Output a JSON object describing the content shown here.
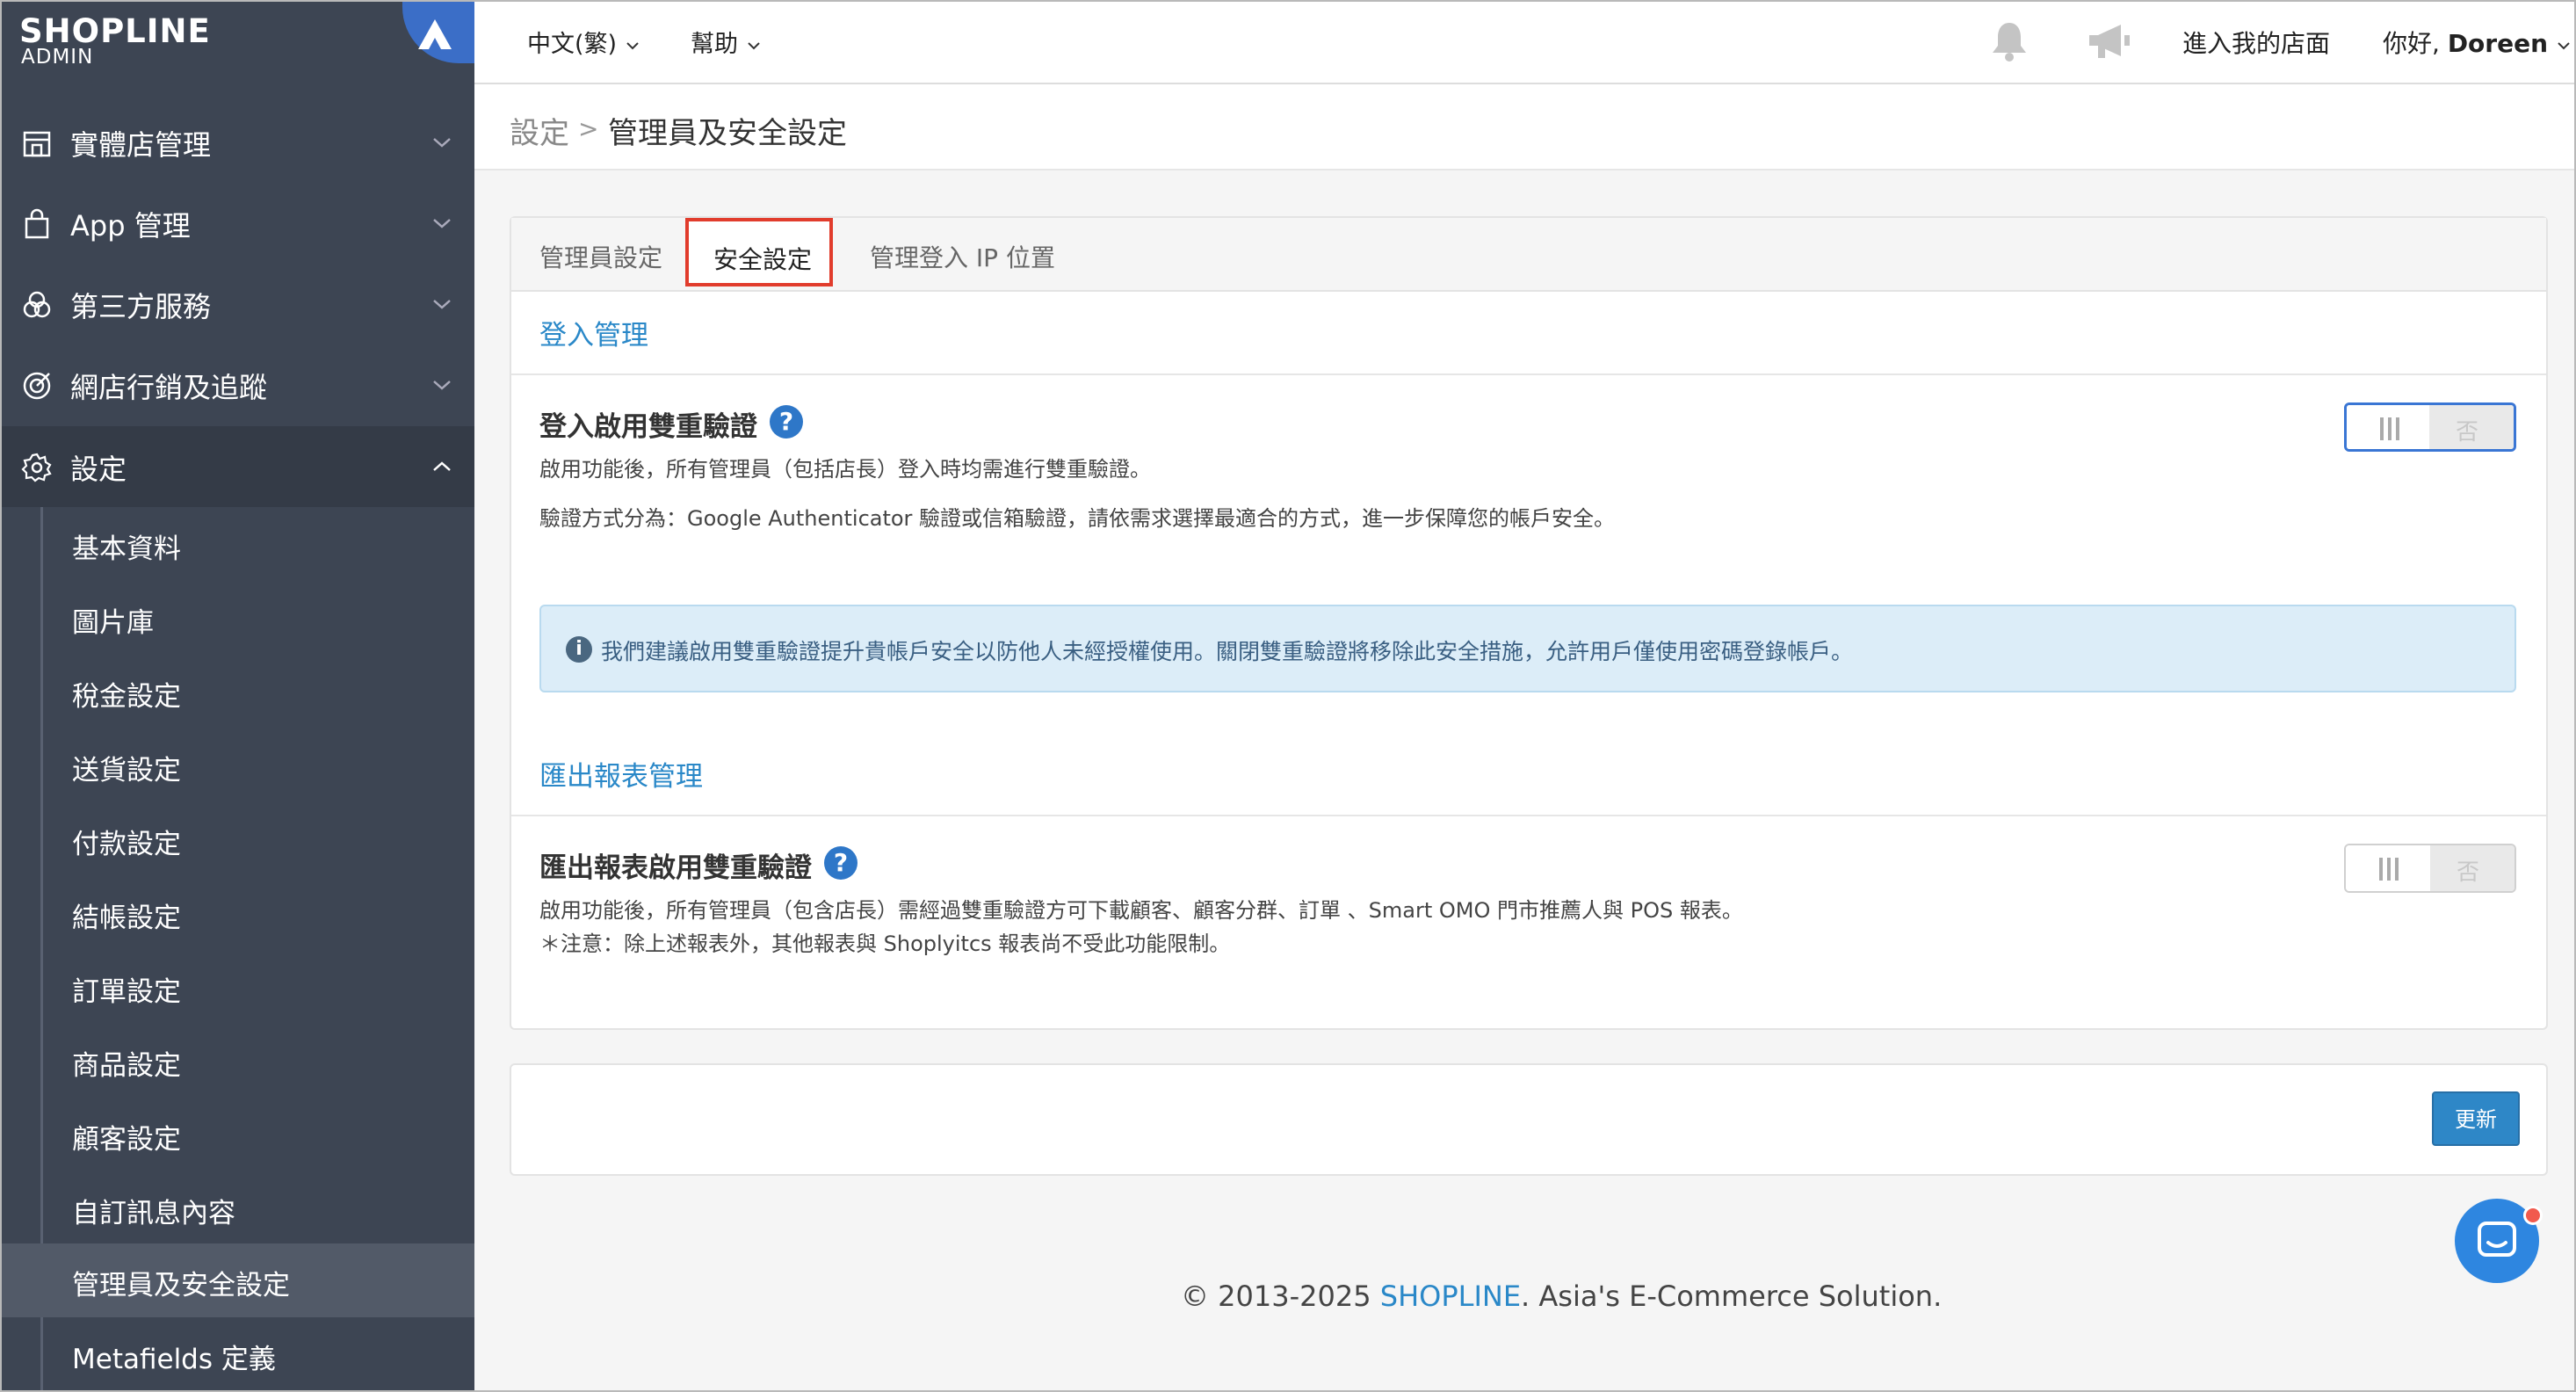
{
  "brand": {
    "name": "SHOPLINE",
    "sub": "ADMIN"
  },
  "sidebar": {
    "items": [
      {
        "label": "實體店管理",
        "icon": "store-icon"
      },
      {
        "label": "App 管理",
        "icon": "shopping-bag-icon"
      },
      {
        "label": "第三方服務",
        "icon": "circles-icon"
      },
      {
        "label": "網店行銷及追蹤",
        "icon": "target-icon"
      },
      {
        "label": "設定",
        "icon": "gear-icon"
      }
    ],
    "sub_items": [
      "基本資料",
      "圖片庫",
      "稅金設定",
      "送貨設定",
      "付款設定",
      "結帳設定",
      "訂單設定",
      "商品設定",
      "顧客設定",
      "自訂訊息內容",
      "管理員及安全設定",
      "Metafields 定義"
    ]
  },
  "topbar": {
    "language": "中文(繁)",
    "help": "幫助",
    "store_link": "進入我的店面",
    "greeting_prefix": "你好, ",
    "user_name": "Doreen"
  },
  "breadcrumb": {
    "parent": "設定",
    "separator": ">",
    "current": "管理員及安全設定"
  },
  "tabs": [
    "管理員設定",
    "安全設定",
    "管理登入 IP 位置"
  ],
  "login_section": {
    "title": "登入管理",
    "setting_title": "登入啟用雙重驗證",
    "desc1": "啟用功能後，所有管理員（包括店長）登入時均需進行雙重驗證。",
    "desc2": "驗證方式分為：Google Authenticator 驗證或信箱驗證，請依需求選擇最適合的方式，進一步保障您的帳戶安全。",
    "toggle_off_label": "否",
    "alert": "我們建議啟用雙重驗證提升貴帳戶安全以防他人未經授權使用。關閉雙重驗證將移除此安全措施，允許用戶僅使用密碼登錄帳戶。"
  },
  "export_section": {
    "title": "匯出報表管理",
    "setting_title": "匯出報表啟用雙重驗證",
    "desc1": "啟用功能後，所有管理員（包含店長）需經過雙重驗證方可下載顧客、顧客分群、訂單 、Smart OMO 門市推薦人與 POS 報表。",
    "desc2": "＊注意：除上述報表外，其他報表與 Shoplyitcs 報表尚不受此功能限制。",
    "toggle_off_label": "否"
  },
  "update_button": "更新",
  "footer": {
    "prefix": "© 2013-2025 ",
    "brand": "SHOPLINE",
    "suffix": ". Asia's E-Commerce Solution."
  },
  "colors": {
    "sidebar": "#3d4553",
    "accent": "#2a88c8",
    "highlight": "#e13c2c"
  }
}
